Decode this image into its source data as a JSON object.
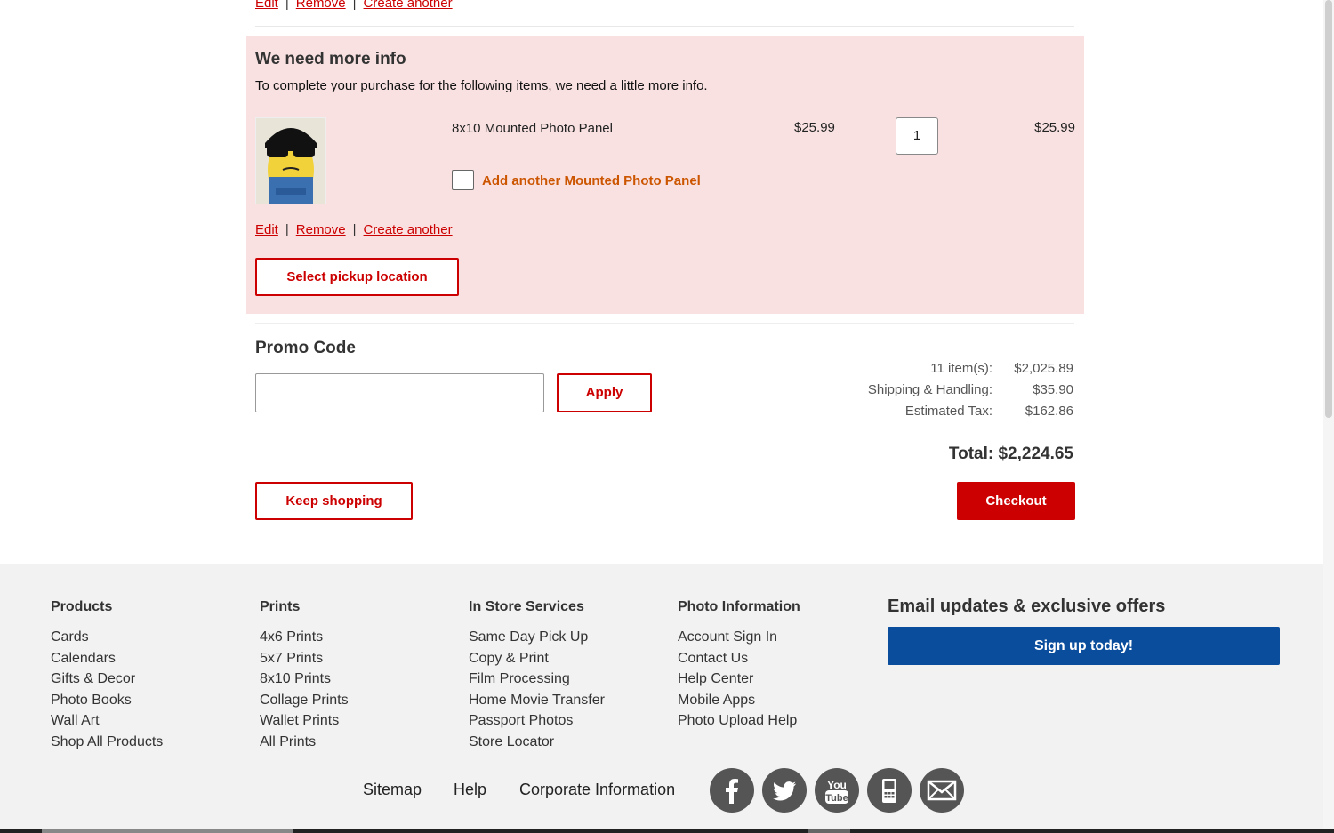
{
  "top_item": {
    "edit": "Edit",
    "remove": "Remove",
    "create": "Create another",
    "sep": "|"
  },
  "info_box": {
    "title": "We need more info",
    "description": "To complete your purchase for the following items, we need a little more info.",
    "product_name": "8x10 Mounted Photo Panel",
    "unit_price": "$25.99",
    "quantity": "1",
    "line_total": "$25.99",
    "addon_label": "Add another Mounted Photo Panel",
    "edit": "Edit",
    "remove": "Remove",
    "create": "Create another",
    "sep": "|",
    "pickup_button": "Select pickup location"
  },
  "promo": {
    "title": "Promo Code",
    "input_value": "",
    "apply_button": "Apply"
  },
  "summary": {
    "items_label": "11 item(s):",
    "items_value": "$2,025.89",
    "shipping_label": "Shipping & Handling:",
    "shipping_value": "$35.90",
    "tax_label": "Estimated Tax:",
    "tax_value": "$162.86",
    "total": "Total: $2,224.65"
  },
  "actions": {
    "keep_shopping": "Keep shopping",
    "checkout": "Checkout"
  },
  "footer": {
    "columns": [
      {
        "title": "Products",
        "links": [
          "Cards",
          "Calendars",
          "Gifts & Decor",
          "Photo Books",
          "Wall Art",
          "Shop All Products"
        ]
      },
      {
        "title": "Prints",
        "links": [
          "4x6 Prints",
          "5x7 Prints",
          "8x10 Prints",
          "Collage Prints",
          "Wallet Prints",
          "All Prints"
        ]
      },
      {
        "title": "In Store Services",
        "links": [
          "Same Day Pick Up",
          "Copy & Print",
          "Film Processing",
          "Home Movie Transfer",
          "Passport Photos",
          "Store Locator"
        ]
      },
      {
        "title": "Photo Information",
        "links": [
          "Account Sign In",
          "Contact Us",
          "Help Center",
          "Mobile Apps",
          "Photo Upload Help"
        ]
      }
    ],
    "email_title": "Email updates & exclusive offers",
    "signup_button": "Sign up today!",
    "bottom_links": [
      "Sitemap",
      "Help",
      "Corporate Information"
    ],
    "social_icons": [
      "facebook-icon",
      "twitter-icon",
      "youtube-icon",
      "mobile-icon",
      "email-icon"
    ],
    "youtube_text_top": "You",
    "youtube_text_bottom": "Tube"
  },
  "colors": {
    "accent_red": "#cc0000",
    "info_bg": "#f9e1e1",
    "addon_orange": "#cc5500",
    "signup_blue": "#0a4d9c",
    "footer_bg": "#f2f2f2"
  }
}
